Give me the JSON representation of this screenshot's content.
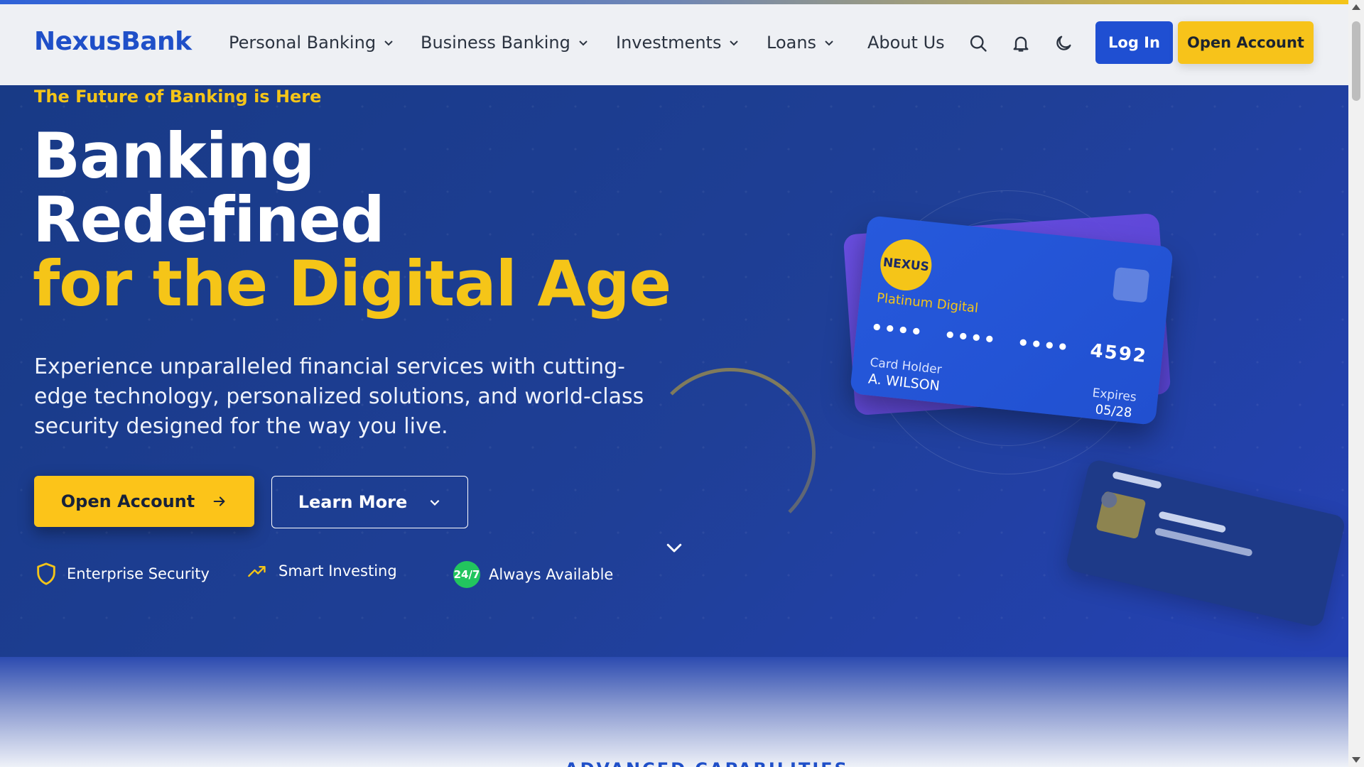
{
  "brand": {
    "name": "NexusBank"
  },
  "nav": {
    "items": [
      {
        "label": "Personal Banking",
        "has_dropdown": true
      },
      {
        "label": "Business Banking",
        "has_dropdown": true
      },
      {
        "label": "Investments",
        "has_dropdown": true
      },
      {
        "label": "Loans",
        "has_dropdown": true
      },
      {
        "label": "About Us",
        "has_dropdown": false
      }
    ],
    "icons": [
      "search-icon",
      "bell-icon",
      "moon-icon"
    ],
    "login_label": "Log In",
    "open_account_label": "Open Account"
  },
  "hero": {
    "tagline": "The Future of Banking is Here",
    "headline_line1": "Banking",
    "headline_line2": "Redefined",
    "headline_line3": "for the Digital Age",
    "description": "Experience unparalleled financial services with cutting-edge technology, personalized solutions, and world-class security designed for the way you live.",
    "primary_cta": "Open Account",
    "secondary_cta": "Learn More",
    "features": [
      {
        "icon": "shield-icon",
        "label": "Enterprise Security"
      },
      {
        "icon": "trending-up-icon",
        "label": "Smart Investing"
      },
      {
        "icon": "badge-247-icon",
        "badge": "24/7",
        "label": "Always Available"
      }
    ]
  },
  "card": {
    "brand": "NEXUS",
    "tier": "Platinum Digital",
    "masked_groups": [
      "••••",
      "••••",
      "••••"
    ],
    "last4": "4592",
    "holder_label": "Card Holder",
    "holder_name": "A. WILSON",
    "expires_label": "Expires",
    "expires_value": "05/28"
  },
  "next_section": {
    "label": "ADVANCED CAPABILITIES"
  },
  "colors": {
    "primary": "#1f4fd2",
    "accent": "#f5c518",
    "hero_bg": "#1f3f97",
    "success": "#22c55e"
  }
}
